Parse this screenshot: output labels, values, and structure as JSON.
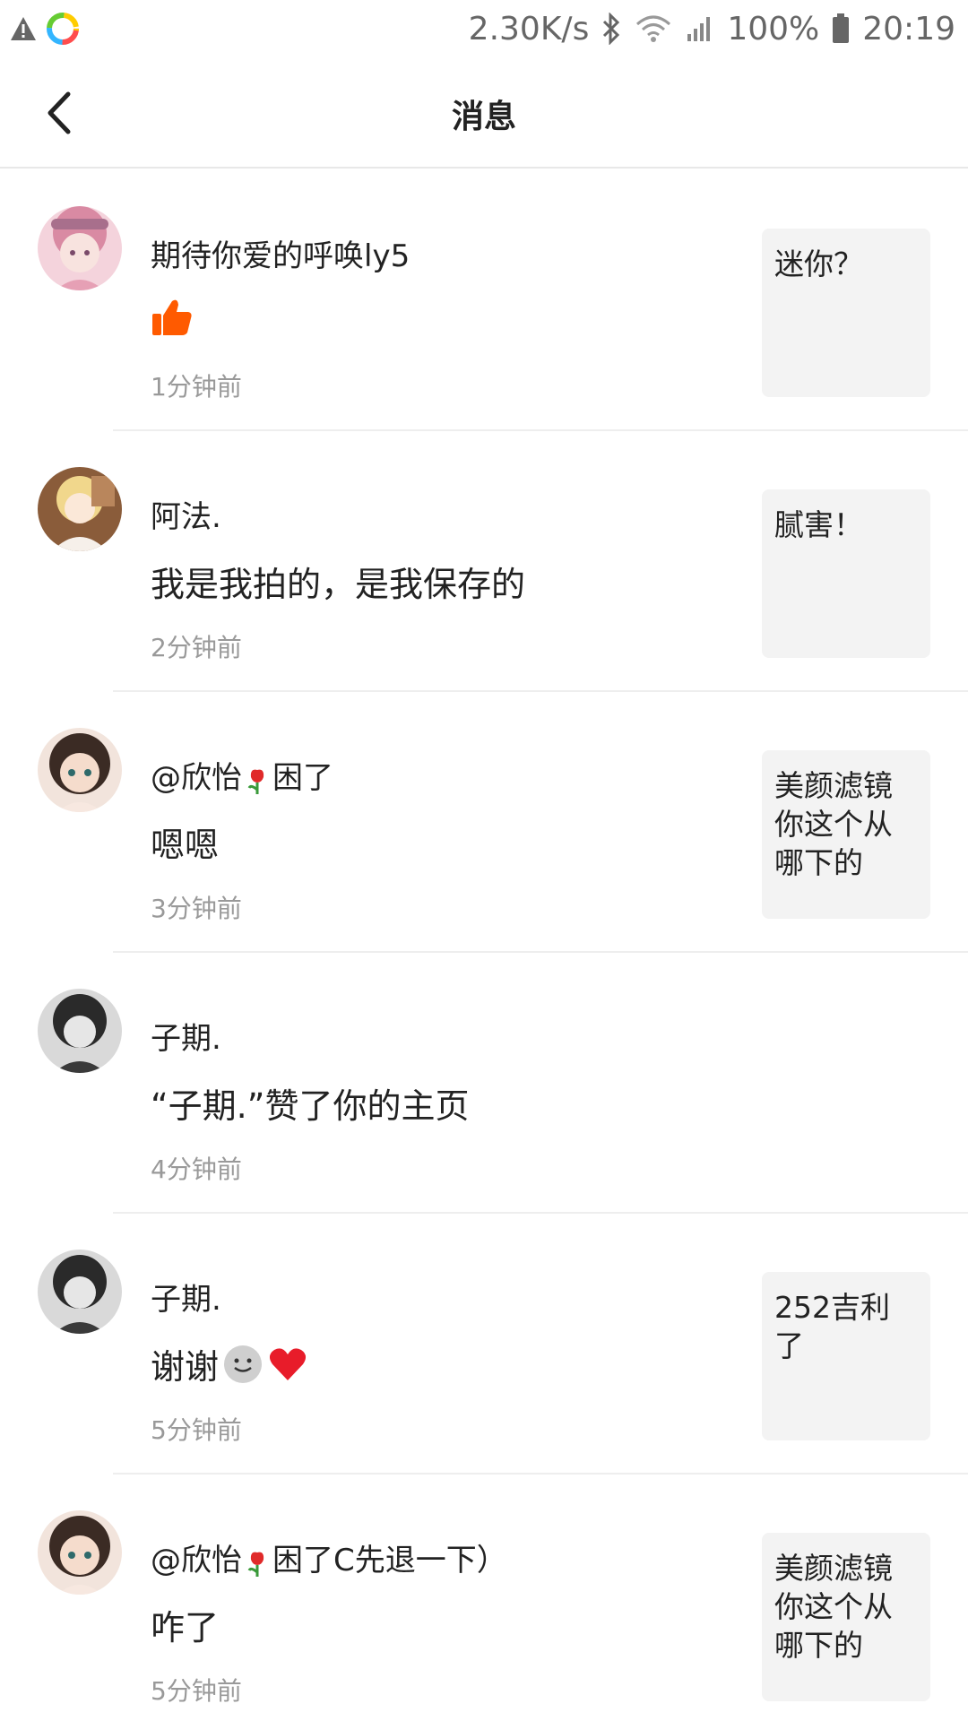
{
  "status_bar": {
    "net_speed": "2.30K/s",
    "battery": "100%",
    "time": "20:19",
    "icons": [
      "warning-icon",
      "app-icon",
      "bluetooth-icon",
      "wifi-icon",
      "signal-icon",
      "battery-icon"
    ]
  },
  "header": {
    "title": "消息",
    "back_icon": "chevron-left-icon"
  },
  "messages": [
    {
      "name": "期待你爱的呼唤ly5",
      "message": "",
      "message_icon": "thumbs-up-icon",
      "time": "1分钟前",
      "preview": "迷你？",
      "avatar_color": "#e8a9b8"
    },
    {
      "name": "阿法.",
      "message": "我是我拍的，是我保存的",
      "time": "2分钟前",
      "preview": "腻害！",
      "avatar_color": "#c79a6a"
    },
    {
      "name_prefix": "@欣怡",
      "name_suffix": "困了",
      "name_icon": "tulip-icon",
      "message": "嗯嗯",
      "time": "3分钟前",
      "preview": "美颜滤镜你这个从哪下的",
      "avatar_color": "#4a3a33"
    },
    {
      "name": "子期.",
      "message": "“子期.”赞了你的主页",
      "time": "4分钟前",
      "preview": "",
      "avatar_color": "#5a5a5a"
    },
    {
      "name": "子期.",
      "message": "谢谢",
      "message_icons": [
        "smile-icon",
        "heart-icon"
      ],
      "time": "5分钟前",
      "preview": "252吉利了",
      "avatar_color": "#5a5a5a"
    },
    {
      "name_prefix": "@欣怡",
      "name_suffix": "困了C先退一下）",
      "name_icon": "tulip-icon",
      "message": "咋了",
      "time": "5分钟前",
      "preview": "美颜滤镜你这个从哪下的",
      "avatar_color": "#4a3a33"
    }
  ]
}
